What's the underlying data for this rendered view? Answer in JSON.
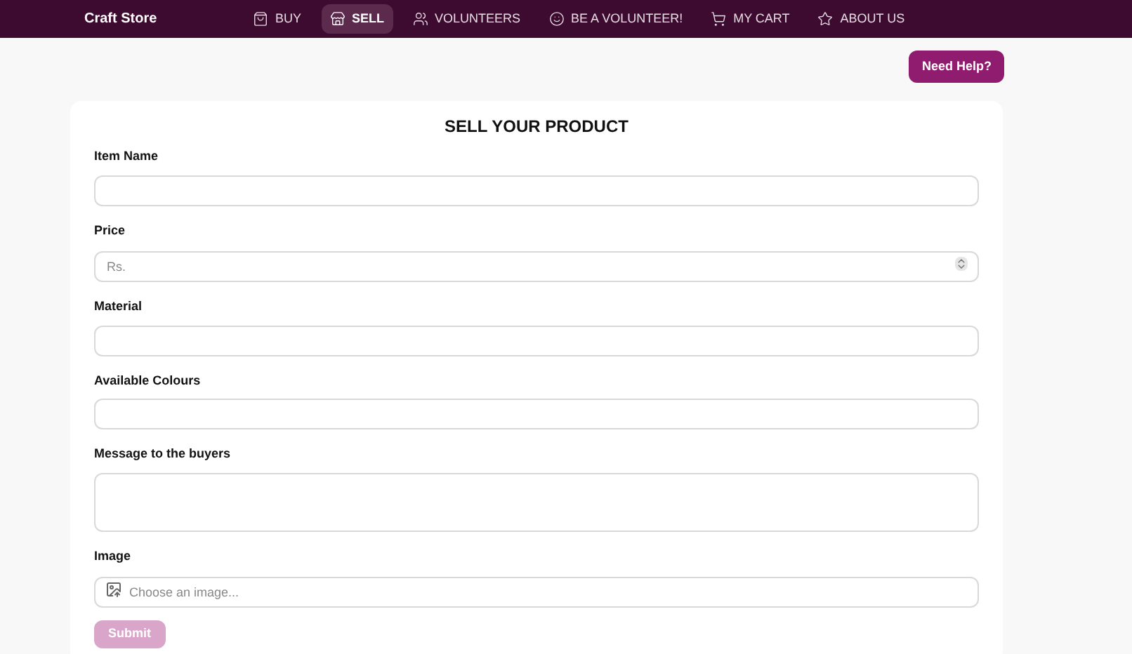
{
  "brand": "Craft Store",
  "nav": [
    {
      "label": "BUY",
      "selected": false
    },
    {
      "label": "SELL",
      "selected": true
    },
    {
      "label": "VOLUNTEERS",
      "selected": false
    },
    {
      "label": "BE A VOLUNTEER!",
      "selected": false
    },
    {
      "label": "MY CART",
      "selected": false
    },
    {
      "label": "ABOUT US",
      "selected": false
    }
  ],
  "help_button": "Need Help?",
  "form": {
    "title": "SELL YOUR PRODUCT",
    "fields": [
      {
        "label": "Item Name",
        "kind": "text"
      },
      {
        "label": "Price",
        "kind": "number",
        "placeholder": "Rs."
      },
      {
        "label": "Material",
        "kind": "text"
      },
      {
        "label": "Available Colours",
        "kind": "text"
      },
      {
        "label": "Message to the buyers",
        "kind": "textarea"
      },
      {
        "label": "Image",
        "kind": "file",
        "placeholder": "Choose an image..."
      }
    ],
    "submit": {
      "label": "Submit",
      "disabled": true
    }
  }
}
